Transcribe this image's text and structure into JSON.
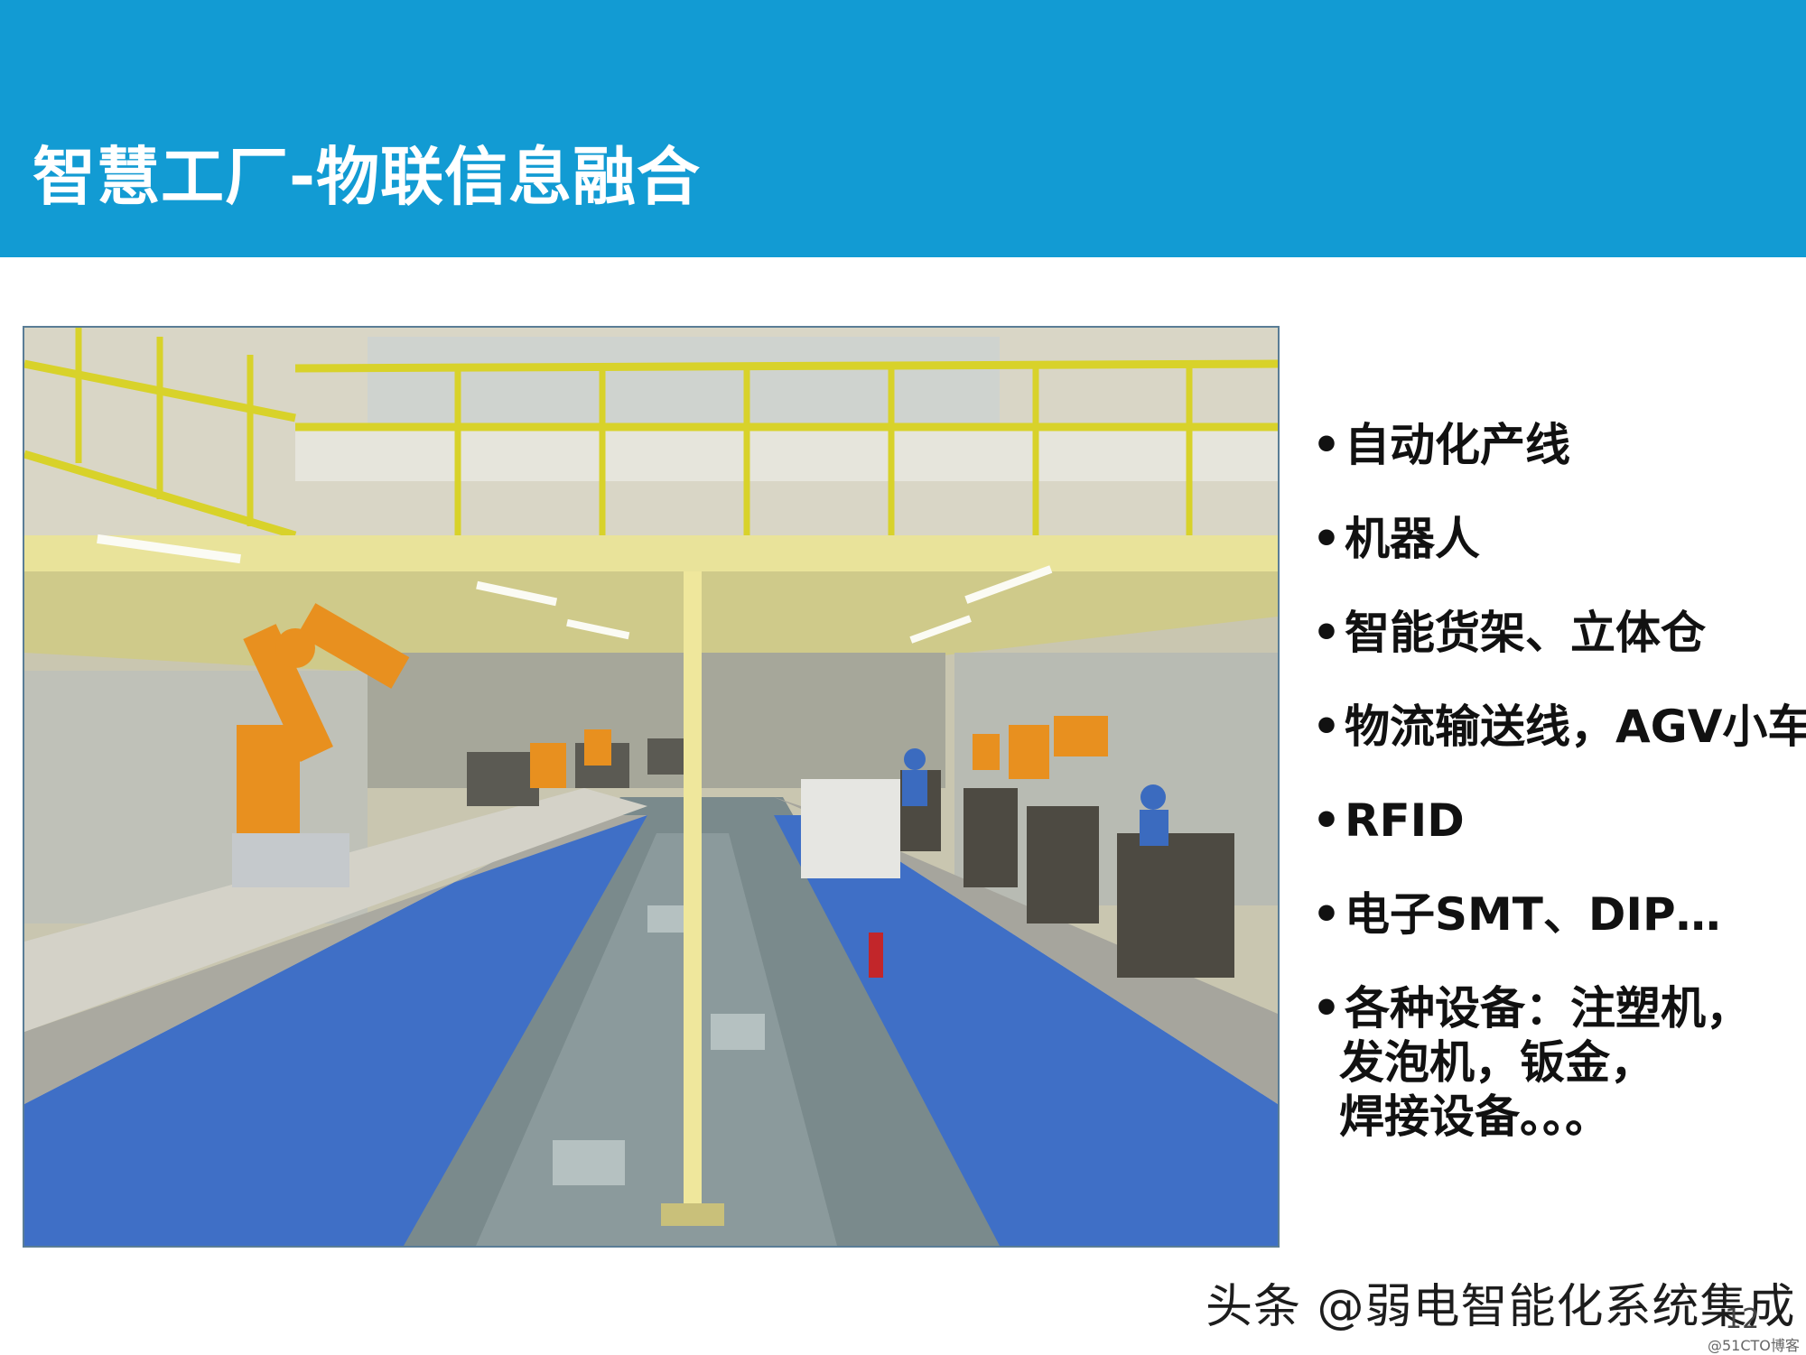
{
  "header": {
    "title": "智慧工厂-物联信息融合",
    "background_color": "#129bd3"
  },
  "photo": {
    "subject": "factory-production-line"
  },
  "bullets": {
    "marker": "•",
    "items": [
      "自动化产线",
      "机器人",
      "智能货架、立体仓",
      "物流输送线，AGV小车",
      "RFID",
      "电子SMT、DIP…"
    ],
    "multiline": [
      "各种设备：注塑机，",
      "发泡机，钣金，",
      "焊接设备。。。"
    ]
  },
  "footer": {
    "watermark": "头条 @弱电智能化系统集成",
    "page_number": "12",
    "source": "@51CTO博客"
  }
}
